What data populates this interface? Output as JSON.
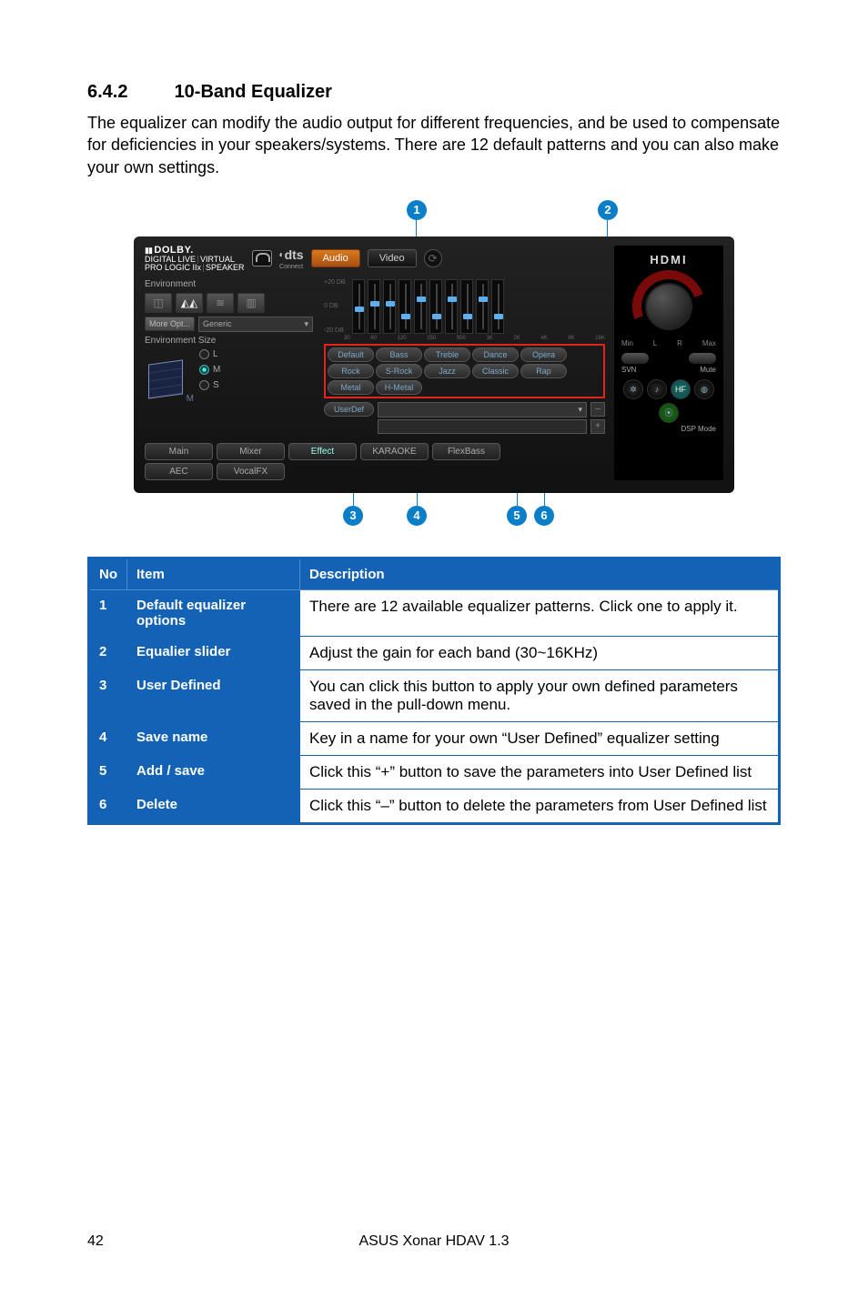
{
  "section": {
    "number": "6.4.2",
    "title": "10-Band Equalizer"
  },
  "intro": "The equalizer can modify the audio output for different frequencies, and be used to compensate for deficiencies in your speakers/systems. There are 12 default patterns and you can also make your own settings.",
  "callouts": {
    "c1": "1",
    "c2": "2",
    "c3": "3",
    "c4": "4",
    "c5": "5",
    "c6": "6"
  },
  "chart_data": {
    "type": "equalizer",
    "bands_hz": [
      30,
      60,
      120,
      250,
      500,
      "1K",
      "2K",
      "4K",
      "8K",
      "16K"
    ],
    "y_labels": [
      "+20 DB",
      "0 DB",
      "-20 DB"
    ],
    "slider_percents": [
      48,
      60,
      60,
      30,
      70,
      30,
      70,
      30,
      70,
      30
    ],
    "range_db": [
      -20,
      20
    ]
  },
  "shot": {
    "dolby": "DOLBY.",
    "dolby_sub1": "DIGITAL LIVE",
    "dolby_sub2": "PRO LOGIC IIx",
    "virtual": "VIRTUAL",
    "speaker": "SPEAKER",
    "dts": "dts",
    "dts_sub": "Connect",
    "tab_audio": "Audio",
    "tab_video": "Video",
    "env_title": "Environment",
    "more_opt": "More Opt...",
    "generic": "Generic",
    "env_size": "Environment Size",
    "size_l": "L",
    "size_m": "M",
    "size_s": "S",
    "presets": {
      "p1": "Default",
      "p2": "Bass",
      "p3": "Treble",
      "p4": "Dance",
      "p5": "Opera",
      "p6": "Rock",
      "p7": "S-Rock",
      "p8": "Jazz",
      "p9": "Classic",
      "p10": "Rap",
      "p11": "Metal",
      "p12": "H-Metal"
    },
    "userdef": "UserDef",
    "dd_arrow": "▾",
    "plus_btn": "+",
    "tabs": {
      "main": "Main",
      "mixer": "Mixer",
      "effect": "Effect",
      "karaoke": "KARAOKE",
      "flexbass": "FlexBass",
      "aec": "AEC",
      "vocalfx": "VocalFX"
    },
    "hdmi": "HDMI",
    "knob_min": "Min",
    "knob_l": "L",
    "knob_r": "R",
    "knob_max": "Max",
    "svn": "SVN",
    "mute": "Mute",
    "hf": "HF",
    "dsp_mode": "DSP Mode",
    "refresh": "⟳"
  },
  "table": {
    "headers": {
      "no": "No",
      "item": "Item",
      "desc": "Description"
    },
    "rows": [
      {
        "no": "1",
        "item": "Default equalizer options",
        "desc": "There are 12 available equalizer patterns. Click one to apply it."
      },
      {
        "no": "2",
        "item": "Equalier slider",
        "desc": "Adjust the gain for each band (30~16KHz)"
      },
      {
        "no": "3",
        "item": "User Defined",
        "desc": "You can click this button to apply your own defined parameters saved in the pull-down menu."
      },
      {
        "no": "4",
        "item": "Save name",
        "desc": "Key in a name for your own “User Defined” equalizer setting"
      },
      {
        "no": "5",
        "item": "Add / save",
        "desc": "Click this “+” button to save the parameters into User Defined list"
      },
      {
        "no": "6",
        "item": "Delete",
        "desc": "Click this “–” button to delete the parameters from User Defined list"
      }
    ]
  },
  "footer": {
    "page": "42",
    "product": "ASUS Xonar HDAV 1.3"
  }
}
